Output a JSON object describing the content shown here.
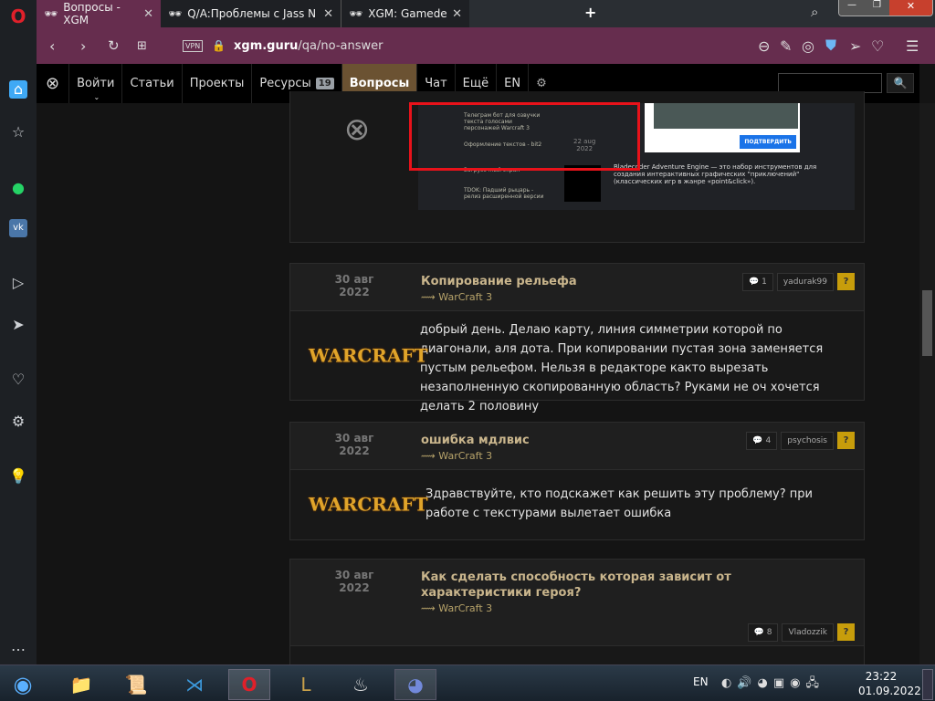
{
  "browser": {
    "tabs": [
      {
        "title": "Вопросы - XGM",
        "active": true
      },
      {
        "title": "Q/A:Проблемы с Jass New"
      },
      {
        "title": "XGM: Gamedev & Modmak"
      }
    ],
    "vpn": "VPN",
    "url_host": "xgm.guru",
    "url_path": "/qa/no-answer"
  },
  "nav": {
    "login": "Войти",
    "items": [
      "Статьи",
      "Проекты",
      "Ресурсы",
      "Вопросы",
      "Чат",
      "Ещё",
      "EN"
    ],
    "resources_badge": "19",
    "search_placeholder": ""
  },
  "embedded": {
    "date": "22 aug",
    "year": "2022",
    "confirm": "ПОДТВЕРДИТЬ",
    "desc": "Bladecoder Adventure Engine — это набор инструментов для создания интерактивных графических \"приключений\" (классических игр в жанре «point&click»).",
    "feed": [
      "Телеграм бот для озвучки текста голосами персонажей Warcraft 3",
      "Оформление текстов - bit2",
      "Загрузочный экран",
      "TDOK: Падший рыцарь - релиз расширенной версии"
    ]
  },
  "questions": [
    {
      "day": "30 авг",
      "year": "2022",
      "title": "Копирование рельефа",
      "category": "WarCraft 3",
      "comments": "1",
      "author": "yadurak99",
      "status": "?",
      "logo": "WarCraft III",
      "body": "добрый день. Делаю карту, линия симметрии которой по диагонали, аля дота. При копировании пустая зона заменяется пустым рельефом. Нельзя в редакторе както вырезать незаполненную скопированную область? Руками не оч хочется делать 2 половину"
    },
    {
      "day": "30 авг",
      "year": "2022",
      "title": "ошибка мдлвис",
      "category": "WarCraft 3",
      "comments": "4",
      "author": "psychosis",
      "status": "?",
      "logo": "WarCraft III",
      "body": "Здравствуйте, кто подскажет как решить эту проблему? при работе с текстурами вылетает ошибка"
    },
    {
      "day": "30 авг",
      "year": "2022",
      "title": "Как сделать способность которая зависит от характеристики героя?",
      "category": "WarCraft 3",
      "comments": "8",
      "author": "Vladozzik",
      "status": "?"
    }
  ],
  "taskbar": {
    "lang": "EN",
    "time": "23:22",
    "date": "01.09.2022"
  },
  "colors": {
    "accent": "#662d4e",
    "active_nav": "#6b5232",
    "title": "#c9b58c",
    "status": "#c79d0b"
  }
}
